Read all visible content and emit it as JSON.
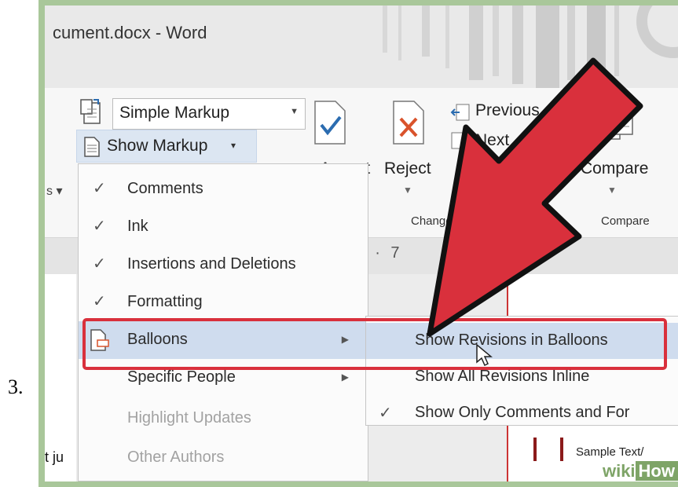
{
  "step_number": "3.",
  "window": {
    "title": "cument.docx - Word"
  },
  "ribbon": {
    "display_combo": "Simple Markup",
    "show_markup": "Show Markup",
    "show_markup_caret": "▾",
    "accept": "Accept",
    "reject": "Reject",
    "previous": "Previous",
    "next": "Next",
    "compare": "Compare",
    "group_changes": "Changes",
    "group_compare": "Compare",
    "left_partial": "s ▾"
  },
  "ruler": {
    "text": "· · 7"
  },
  "menu": {
    "items": [
      {
        "check": "✓",
        "label": "Comments",
        "arrow": ""
      },
      {
        "check": "✓",
        "label": "Ink",
        "arrow": ""
      },
      {
        "check": "✓",
        "label": "Insertions and Deletions",
        "arrow": ""
      },
      {
        "check": "✓",
        "label": "Formatting",
        "arrow": ""
      },
      {
        "check": "",
        "label": "Balloons",
        "arrow": "▶"
      },
      {
        "check": "",
        "label": "Specific People",
        "arrow": "▶"
      },
      {
        "check": "",
        "label": "Highlight Updates",
        "arrow": ""
      },
      {
        "check": "",
        "label": "Other Authors",
        "arrow": ""
      }
    ]
  },
  "submenu": {
    "items": [
      {
        "check": "",
        "label": "Show Revisions in Balloons"
      },
      {
        "check": "",
        "label": "Show All Revisions Inline"
      },
      {
        "check": "✓",
        "label": "Show Only Comments and For"
      }
    ]
  },
  "document": {
    "sample_text": "Sample Text/",
    "left_text": "t ju"
  },
  "watermark": {
    "wiki": "wiki",
    "how": "How"
  },
  "colors": {
    "highlight_box": "#d9303c",
    "arrow_fill": "#d9303c",
    "menu_hover": "#cfdcee",
    "frame": "#a9c79a"
  },
  "icons": [
    "show-markup-doc-icon",
    "display-for-review-icon",
    "accept-check-icon",
    "reject-x-icon",
    "previous-icon",
    "next-icon",
    "compare-icon",
    "balloons-icon",
    "mouse-cursor-icon",
    "annotation-arrow"
  ]
}
